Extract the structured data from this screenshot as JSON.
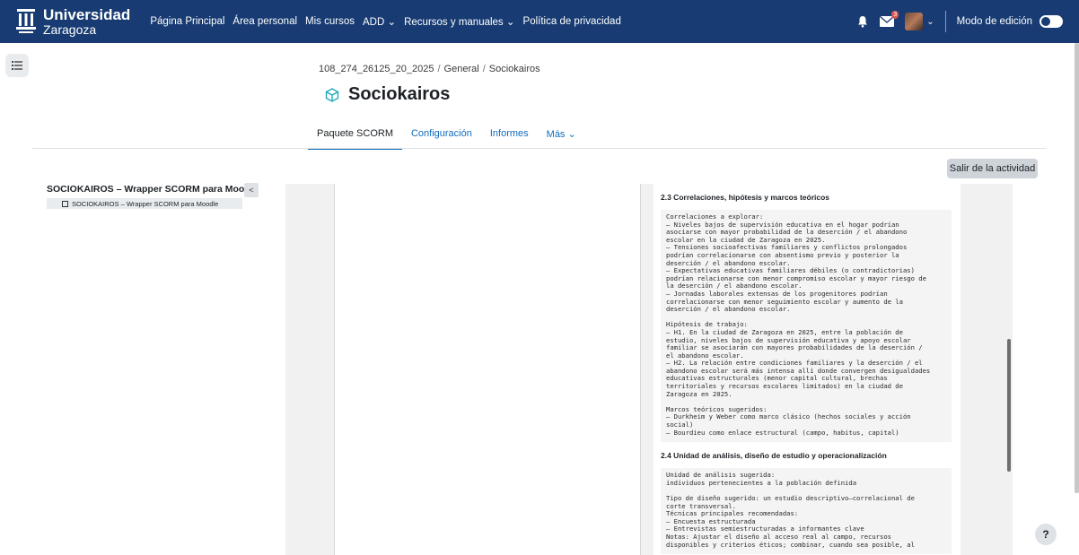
{
  "brand": {
    "line1": "Universidad",
    "line2": "Zaragoza"
  },
  "nav": {
    "items": [
      "Página Principal",
      "Área personal",
      "Mis cursos",
      "ADD",
      "Recursos y manuales",
      "Política de privacidad"
    ],
    "add_chevron": "⌄",
    "recursos_chevron": "⌄",
    "msg_badge": "3",
    "edit_mode_label": "Modo de edición"
  },
  "breadcrumb": {
    "course": "108_274_26125_20_2025",
    "section": "General",
    "activity": "Sociokairos",
    "sep": "/"
  },
  "page_title": "Sociokairos",
  "tabs": [
    {
      "label": "Paquete SCORM",
      "active": true
    },
    {
      "label": "Configuración"
    },
    {
      "label": "Informes"
    },
    {
      "label": "Más ⌄"
    }
  ],
  "exit_button": "Salir de la actividad",
  "toc": {
    "title": "SOCIOKAIROS – Wrapper SCORM para Moodle",
    "item": "SOCIOKAIROS – Wrapper SCORM para Moodle",
    "collapse": "<"
  },
  "doc": {
    "section_23_title": "2.3 Correlaciones, hipótesis y marcos teóricos",
    "section_23_body": "Correlaciones a explorar:\n– Niveles bajos de supervisión educativa en el hogar podrían\nasociarse con mayor probabilidad de la deserción / el abandono\nescolar en la ciudad de Zaragoza en 2025.\n– Tensiones socioafectivas familiares y conflictos prolongados\npodrían correlacionarse con absentismo previo y posterior la\ndeserción / el abandono escolar.\n– Expectativas educativas familiares débiles (o contradictorias)\npodrían relacionarse con menor compromiso escolar y mayor riesgo de\nla deserción / el abandono escolar.\n– Jornadas laborales extensas de los progenitores podrían\ncorrelacionarse con menor seguimiento escolar y aumento de la\ndeserción / el abandono escolar.\n\nHipótesis de trabajo:\n– H1. En la ciudad de Zaragoza en 2025, entre la población de\nestudio, niveles bajos de supervisión educativa y apoyo escolar\nfamiliar se asociarán con mayores probabilidades de la deserción /\nel abandono escolar.\n– H2. La relación entre condiciones familiares y la deserción / el\nabandono escolar será más intensa allí donde convergen desigualdades\neducativas estructurales (menor capital cultural, brechas\nterritoriales y recursos escolares limitados) en la ciudad de\nZaragoza en 2025.\n\nMarcos teóricos sugeridos:\n– Durkheim y Weber como marco clásico (hechos sociales y acción\nsocial)\n– Bourdieu como enlace estructural (campo, habitus, capital)",
    "section_24_title": "2.4 Unidad de análisis, diseño de estudio y operacionalización",
    "section_24_body": "Unidad de análisis sugerida:\nindividuos pertenecientes a la población definida\n\nTipo de diseño sugerido: un estudio descriptivo–correlacional de\ncorte transversal.\nTécnicas principales recomendadas:\n– Encuesta estructurada\n– Entrevistas semiestructuradas a informantes clave\nNotas: Ajustar el diseño al acceso real al campo, recursos\ndisponibles y criterios éticos; combinar, cuando sea posible, al"
  },
  "help": "?"
}
